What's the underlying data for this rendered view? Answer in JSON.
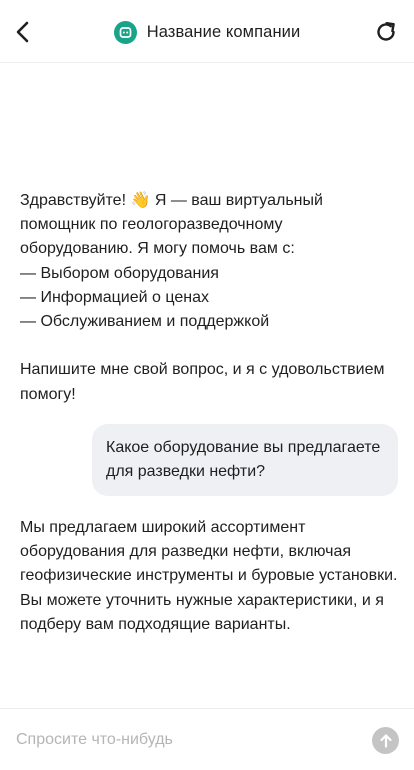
{
  "header": {
    "title": "Название компании",
    "back_icon": "chevron-left-icon",
    "refresh_icon": "refresh-icon",
    "logo_icon": "chat-bot-icon",
    "logo_color": "#19a38a"
  },
  "messages": [
    {
      "role": "bot",
      "text": "Здравствуйте! 👋 Я — ваш виртуальный помощник по геологоразведочному оборудованию. Я могу помочь вам с:\n— Выбором оборудования\n— Информацией о ценах\n— Обслуживанием и поддержкой\n\nНапишите мне свой вопрос, и я с удовольствием помогу!"
    },
    {
      "role": "user",
      "text": "Какое оборудование вы предлагаете для разведки нефти?"
    },
    {
      "role": "bot",
      "text": "Мы предлагаем широкий ассортимент оборудования для разведки нефти, включая геофизические инструменты и буровые установки. Вы можете уточнить нужные характеристики, и я подберу вам подходящие варианты."
    }
  ],
  "composer": {
    "placeholder": "Спросите что-нибудь",
    "value": "",
    "send_icon": "arrow-up-icon"
  },
  "colors": {
    "bubble_user": "#eef0f3",
    "send_button_disabled": "#c4c4c4"
  }
}
